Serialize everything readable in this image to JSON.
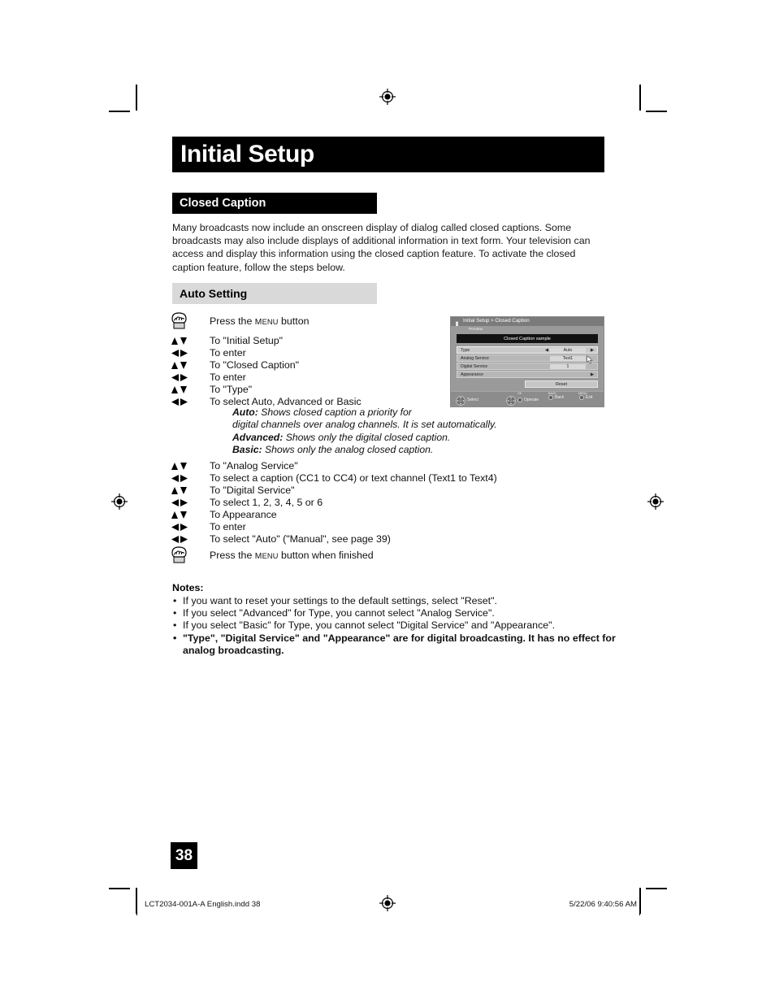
{
  "document": {
    "page_title": "Initial Setup",
    "page_number": "38"
  },
  "section": {
    "heading": "Closed Caption",
    "intro": "Many broadcasts now include an onscreen display of dialog called closed captions. Some broadcasts may also include displays of additional information in text form. Your television can access and display this information using the closed caption feature. To activate the closed caption feature, follow the steps below.",
    "sub_heading": "Auto Setting"
  },
  "steps_group_1": [
    {
      "icon": "hand-press-icon",
      "text_pre": "Press the ",
      "text_sc": "Menu",
      "text_post": " button"
    },
    {
      "icon": "up-down-arrows-icon",
      "text": "To \"Initial Setup\""
    },
    {
      "icon": "left-right-arrows-icon",
      "text": "To enter"
    },
    {
      "icon": "up-down-arrows-icon",
      "text": "To \"Closed Caption\""
    },
    {
      "icon": "left-right-arrows-icon",
      "text": "To enter"
    },
    {
      "icon": "up-down-arrows-icon",
      "text": "To \"Type\""
    },
    {
      "icon": "left-right-arrows-icon",
      "text": "To select Auto, Advanced or Basic"
    }
  ],
  "explanations": [
    {
      "term": "Auto:",
      "desc": " Shows closed caption a priority for"
    },
    {
      "term": "",
      "desc": "digital channels over analog channels.  It is set automatically."
    },
    {
      "term": "Advanced:",
      "desc": "  Shows only the digital closed caption."
    },
    {
      "term": "Basic:",
      "desc": "  Shows only the analog closed caption."
    }
  ],
  "steps_group_2": [
    {
      "icon": "up-down-arrows-icon",
      "text": "To \"Analog Service\""
    },
    {
      "icon": "left-right-arrows-icon",
      "text": "To select a caption (CC1 to CC4) or text channel (Text1 to Text4)"
    },
    {
      "icon": "up-down-arrows-icon",
      "text": "To \"Digital Service\""
    },
    {
      "icon": "left-right-arrows-icon",
      "text": "To select 1, 2, 3, 4, 5 or 6"
    },
    {
      "icon": "up-down-arrows-icon",
      "text": "To Appearance"
    },
    {
      "icon": "left-right-arrows-icon",
      "text": "To enter"
    },
    {
      "icon": "left-right-arrows-icon",
      "text": "To select \"Auto\" (\"Manual\", see page 39)"
    },
    {
      "icon": "hand-press-icon",
      "text_pre": "Press the ",
      "text_sc": "Menu",
      "text_post": " button when finished"
    }
  ],
  "notes": {
    "heading": "Notes:",
    "items": [
      "If you want to reset your settings to the default settings, select \"Reset\".",
      "If you select \"Advanced\" for Type, you cannot select \"Analog Service\".",
      "If you select \"Basic\" for Type, you cannot select \"Digital Service\" and \"Appearance\".",
      "\"Type\", \"Digital Service\" and \"Appearance\" are for digital broadcasting.  It has no effect for analog broadcasting."
    ]
  },
  "osd": {
    "breadcrumb": "Initial Setup > Closed Caption",
    "preview_label": "Preview",
    "sample_text": "Closed Caption sample",
    "rows": [
      {
        "label": "Type",
        "value": "Auto",
        "left_arrow": "◀",
        "right_arrow": "▶",
        "selected": true,
        "has_box": true
      },
      {
        "label": "Analog Service",
        "value": "Text1",
        "left_arrow": "",
        "right_arrow": "",
        "selected": false,
        "has_box": true
      },
      {
        "label": "Digital Service",
        "value": "1",
        "left_arrow": "",
        "right_arrow": "",
        "selected": false,
        "has_box": true
      },
      {
        "label": "Appearance",
        "value": "",
        "left_arrow": "",
        "right_arrow": "▶",
        "selected": false,
        "has_box": false
      }
    ],
    "reset_label": "Reset",
    "footer": [
      {
        "sup": "",
        "label": "Select",
        "control": "dpad"
      },
      {
        "sup": "OK",
        "label": "Operate",
        "control": "dpad-dot"
      },
      {
        "sup": "BACK",
        "label": "Back",
        "control": "dot"
      },
      {
        "sup": "MENU",
        "label": "Exit",
        "control": "dot"
      }
    ]
  },
  "footer": {
    "left": "LCT2034-001A-A English.indd   38",
    "right": "5/22/06   9:40:56 AM"
  },
  "colors": {
    "title_bar_bg": "#000000",
    "sub_bar_bg": "#d9d9d9",
    "osd_bg": "#9a9a9a",
    "osd_header_bg": "#7b7b7b",
    "osd_sample_bg": "#121212"
  }
}
